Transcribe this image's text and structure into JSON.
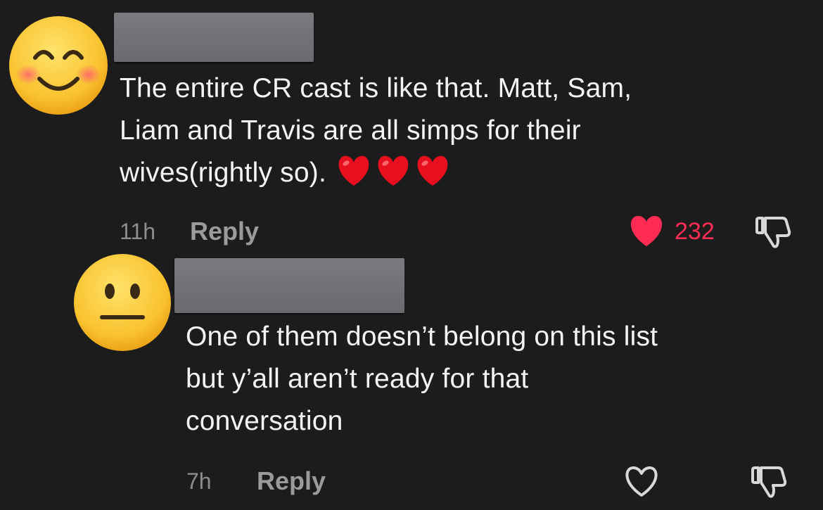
{
  "comments": [
    {
      "avatar": "smiling-blushing-emoji",
      "text": "The entire CR cast is like that. Matt, Sam, Liam and Travis are all simps for their wives(rightly so).",
      "line1": "The entire CR cast is like that. Matt, Sam,",
      "line2": "Liam and Travis are all simps for their",
      "line3": "wives(rightly so).",
      "emoji_suffix": "heart-emoji x3",
      "time": "11h",
      "reply_label": "Reply",
      "like_count": "232",
      "liked": true
    },
    {
      "avatar": "neutral-face-emoji",
      "line1": "One of them doesn’t belong on this list",
      "line2": "but y’all aren’t ready for that",
      "line3": "conversation",
      "time": "7h",
      "reply_label": "Reply",
      "liked": false
    }
  ],
  "colors": {
    "background": "#1c1c1c",
    "like_active": "#fe2c55",
    "muted_text": "#8d8d8d"
  }
}
